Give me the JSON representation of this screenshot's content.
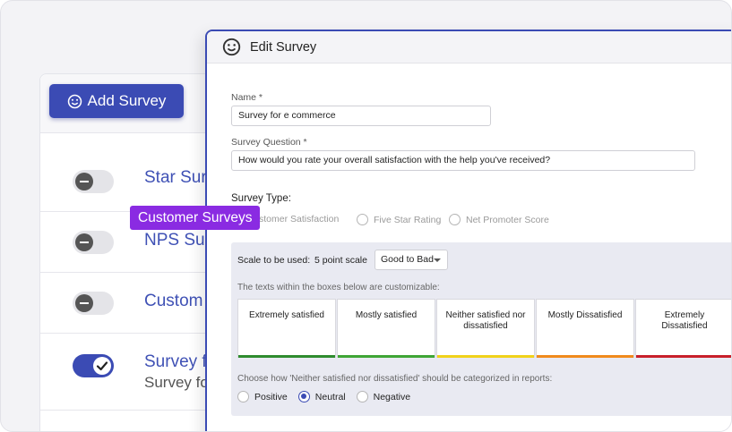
{
  "list": {
    "add_button_label": "Add Survey",
    "rows": [
      {
        "title": "Star Sur",
        "subtitle": "",
        "enabled": false
      },
      {
        "title": "NPS Sur",
        "subtitle": "",
        "enabled": false
      },
      {
        "title": "Custom",
        "subtitle": "",
        "enabled": false
      },
      {
        "title": "Survey f",
        "subtitle": "Survey fo",
        "enabled": true
      }
    ]
  },
  "tooltip": {
    "text": "Customer Surveys"
  },
  "dialog": {
    "title": "Edit Survey",
    "name_label": "Name *",
    "name_value": "Survey for e commerce",
    "question_label": "Survey Question *",
    "question_value": "How would you rate your overall satisfaction with the help you've received?",
    "type_label": "Survey Type:",
    "type_options": [
      {
        "label": "Customer Satisfaction",
        "visible_text": "stomer Satisfaction",
        "selected": false
      },
      {
        "label": "Five Star Rating",
        "selected": false
      },
      {
        "label": "Net Promoter Score",
        "selected": false
      }
    ],
    "scale_label": "Scale to be used:",
    "scale_points": "5 point scale",
    "scale_select": "Good to Bad",
    "customizable_hint": "The texts within the boxes below are customizable:",
    "scale_items": [
      {
        "text": "Extremely satisfied",
        "color": "#2e8b2e"
      },
      {
        "text": "Mostly satisfied",
        "color": "#3fa535"
      },
      {
        "text": "Neither satisfied nor dissatisfied",
        "color": "#f1d21a"
      },
      {
        "text": "Mostly Dissatisfied",
        "color": "#f08a1c"
      },
      {
        "text": "Extremely Dissatisfied",
        "color": "#c8202a"
      }
    ],
    "categorize_hint": "Choose how 'Neither satisfied nor dissatisfied' should be categorized in reports:",
    "categorize_options": [
      {
        "label": "Positive",
        "selected": false
      },
      {
        "label": "Neutral",
        "selected": true
      },
      {
        "label": "Negative",
        "selected": false
      }
    ]
  },
  "colors": {
    "accent": "#3b4bb4",
    "tooltip": "#8a2be2"
  }
}
